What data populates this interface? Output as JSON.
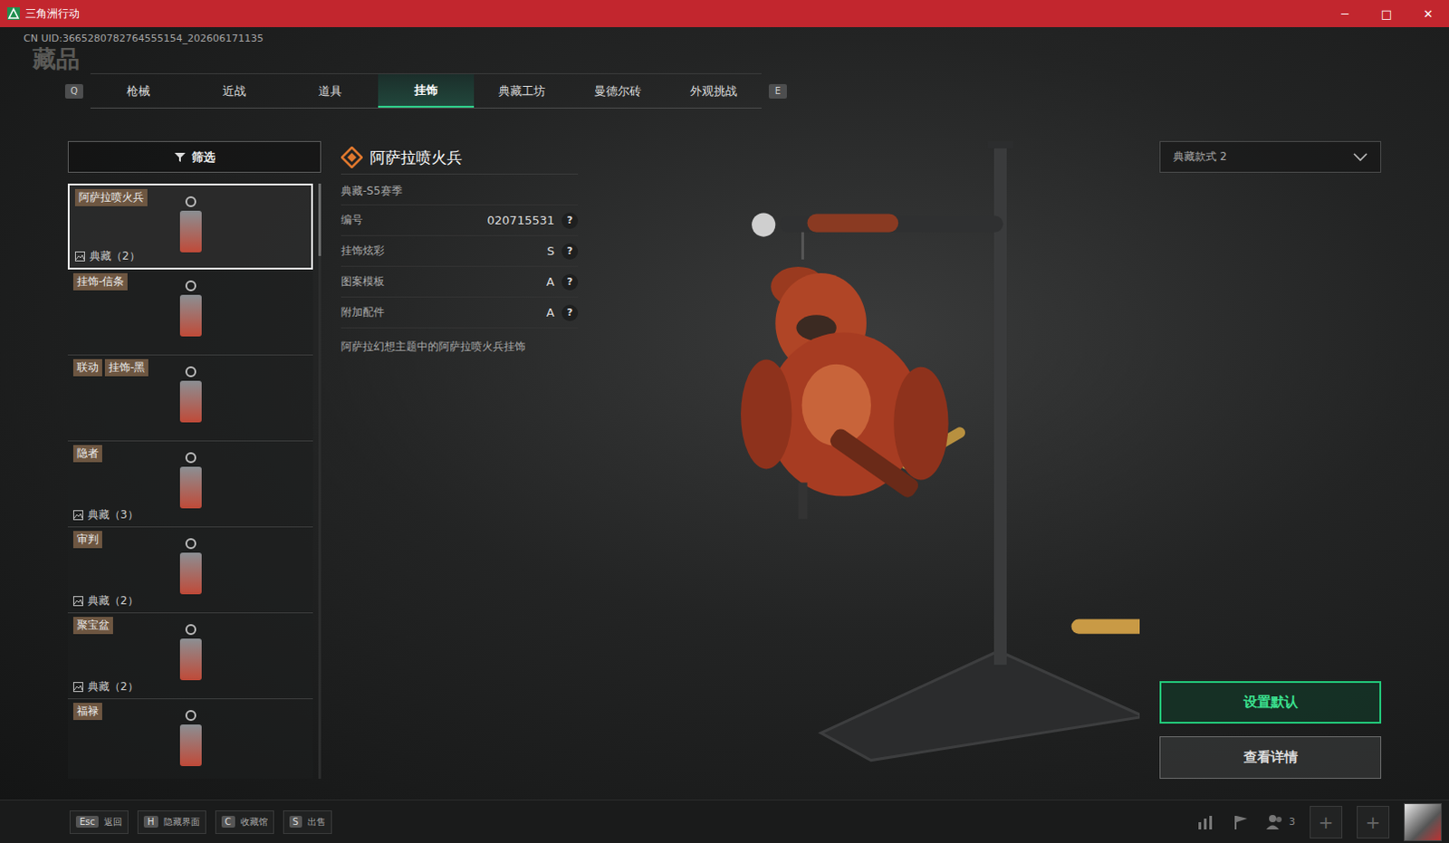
{
  "window": {
    "title": "三角洲行动",
    "controls": [
      "─",
      "□",
      "✕"
    ]
  },
  "uid": "CN UID:3665280782764555154_202606171135",
  "page_title": "藏品",
  "tabs": {
    "prev_key": "Q",
    "next_key": "E",
    "items": [
      {
        "label": "枪械",
        "selected": false
      },
      {
        "label": "近战",
        "selected": false
      },
      {
        "label": "道具",
        "selected": false
      },
      {
        "label": "挂饰",
        "selected": true
      },
      {
        "label": "典藏工坊",
        "selected": false
      },
      {
        "label": "曼德尔砖",
        "selected": false
      },
      {
        "label": "外观挑战",
        "selected": false
      }
    ]
  },
  "filter": {
    "label": "筛选"
  },
  "items": [
    {
      "tags": [
        "阿萨拉喷火兵"
      ],
      "count": "典藏（2）",
      "selected": true
    },
    {
      "tags": [
        "挂饰-信条"
      ],
      "count": "",
      "selected": false
    },
    {
      "tags": [
        "联动",
        "挂饰-黑"
      ],
      "count": "",
      "selected": false
    },
    {
      "tags": [
        "隐者"
      ],
      "count": "典藏（3）",
      "selected": false
    },
    {
      "tags": [
        "审判"
      ],
      "count": "典藏（2）",
      "selected": false
    },
    {
      "tags": [
        "聚宝盆"
      ],
      "count": "典藏（2）",
      "selected": false
    },
    {
      "tags": [
        "福禄"
      ],
      "count": "",
      "selected": false
    }
  ],
  "detail": {
    "name": "阿萨拉喷火兵",
    "season": "典藏-S5赛季",
    "rows": [
      {
        "label": "编号",
        "value": "020715531",
        "help": "?"
      },
      {
        "label": "挂饰炫彩",
        "value": "S",
        "help": "?"
      },
      {
        "label": "图案模板",
        "value": "A",
        "help": "?"
      },
      {
        "label": "附加配件",
        "value": "A",
        "help": "?"
      }
    ],
    "description": "阿萨拉幻想主题中的阿萨拉喷火兵挂饰"
  },
  "style_select": {
    "value": "典藏款式 2"
  },
  "buttons": [
    {
      "label": "设置默认",
      "primary": true
    },
    {
      "label": "查看详情",
      "primary": false
    }
  ],
  "hotkeys": [
    {
      "key": "Esc",
      "label": "返回"
    },
    {
      "key": "H",
      "label": "隐藏界面"
    },
    {
      "key": "C",
      "label": "收藏馆"
    },
    {
      "key": "S",
      "label": "出售"
    }
  ],
  "friends_count": "3",
  "plus_slots": [
    "+",
    "+"
  ]
}
